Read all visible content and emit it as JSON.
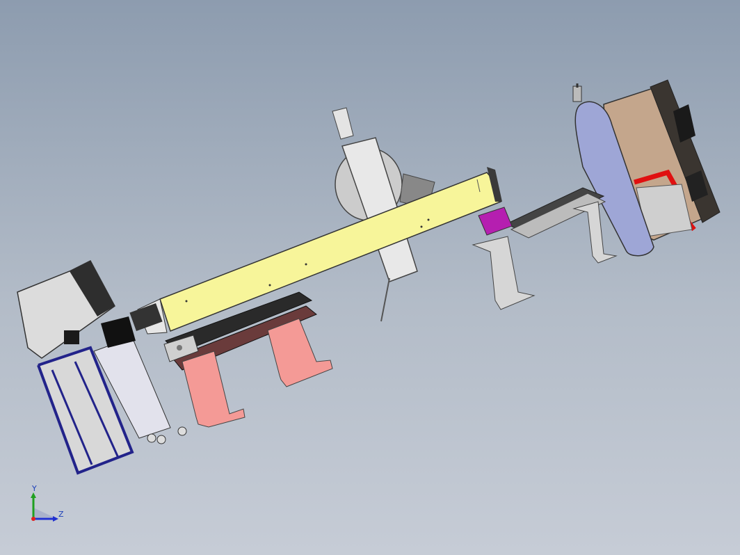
{
  "viewport": {
    "background_top": "#8d9caf",
    "background_bottom": "#c6ccd6"
  },
  "model_colors": {
    "beam": "#f7f59a",
    "pedestal": "#f49a96",
    "frame": "#22238a",
    "gas_cylinder": "#9ea6d6",
    "cabinet": "#c4a68c",
    "accent_red": "#e01010",
    "magenta_block": "#b51fb0",
    "steel": "#d6d6d6"
  },
  "orientation_triad": {
    "x_color": "#e02020",
    "y_color": "#20a020",
    "z_color": "#2030d0",
    "labels": {
      "y": "Y",
      "z": "Z"
    }
  }
}
